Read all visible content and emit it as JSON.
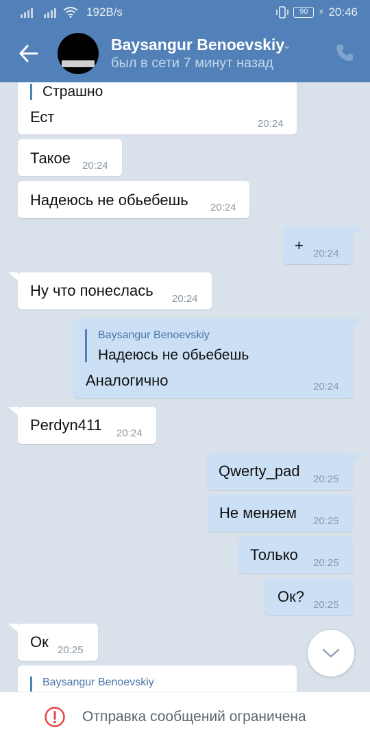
{
  "status_bar": {
    "speed": "192B/s",
    "battery": "90",
    "time": "20:46"
  },
  "header": {
    "contact_name": "Baysangur Benoevskiy",
    "last_seen": "был в сети 7 минут назад"
  },
  "messages": [
    {
      "dir": "in",
      "reply_text": "Страшно",
      "text": "Ест",
      "time": "20:24"
    },
    {
      "dir": "in",
      "text": "Такое",
      "time": "20:24"
    },
    {
      "dir": "in",
      "text": "Надеюсь не обьебешь",
      "time": "20:24"
    },
    {
      "dir": "out",
      "text": "+",
      "time": "20:24"
    },
    {
      "dir": "in",
      "text": "Ну что понеслась",
      "time": "20:24"
    },
    {
      "dir": "out",
      "reply_name": "Baysangur Benoevskiy",
      "reply_text": "Надеюсь не обьебешь",
      "text": "Аналогично",
      "time": "20:24"
    },
    {
      "dir": "in",
      "text": "Perdyn411",
      "time": "20:24"
    },
    {
      "dir": "out",
      "text": "Qwerty_pad",
      "time": "20:25"
    },
    {
      "dir": "out",
      "text": "Не меняем",
      "time": "20:25"
    },
    {
      "dir": "out",
      "text": "Только",
      "time": "20:25"
    },
    {
      "dir": "out",
      "text": "Ок?",
      "time": "20:25"
    },
    {
      "dir": "in",
      "text": "Ок",
      "time": "20:25"
    },
    {
      "dir": "in",
      "reply_name": "Baysangur Benoevskiy"
    }
  ],
  "footer": {
    "notice": "Отправка сообщений ограничена"
  },
  "colors": {
    "header": "#5181b8",
    "background": "#d9e2ea",
    "outgoing": "#cce0f5",
    "incoming": "#ffffff",
    "warning": "#e64646"
  },
  "icons": {
    "back": "arrow-left-icon",
    "call": "phone-icon",
    "scroll": "chevron-down-icon",
    "warning": "exclamation-circle-icon"
  }
}
